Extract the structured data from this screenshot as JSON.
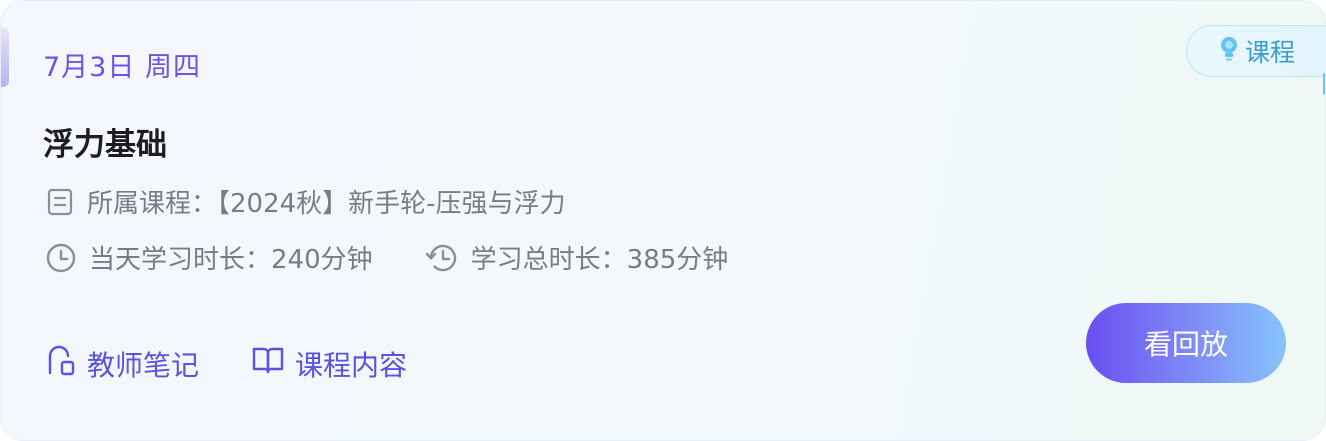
{
  "card": {
    "date": "7月3日 周四",
    "tag": {
      "label": "课程",
      "icon": "lightbulb-icon"
    },
    "title": "浮力基础",
    "course": {
      "label": "所属课程：",
      "value": "【2024秋】新手轮-压强与浮力",
      "icon": "document-icon"
    },
    "today_duration": {
      "label": "当天学习时长：",
      "value": "240分钟",
      "icon": "clock-icon"
    },
    "total_duration": {
      "label": "学习总时长：",
      "value": "385分钟",
      "icon": "history-clock-icon"
    },
    "links": [
      {
        "label": "教师笔记",
        "icon": "teacher-note-icon"
      },
      {
        "label": "课程内容",
        "icon": "open-book-icon"
      }
    ],
    "replay_button": "看回放"
  },
  "colors": {
    "accent": "#6a55e6",
    "tag_text": "#3a9ed2",
    "muted_text": "#787c84",
    "title_text": "#1d1d1f"
  }
}
